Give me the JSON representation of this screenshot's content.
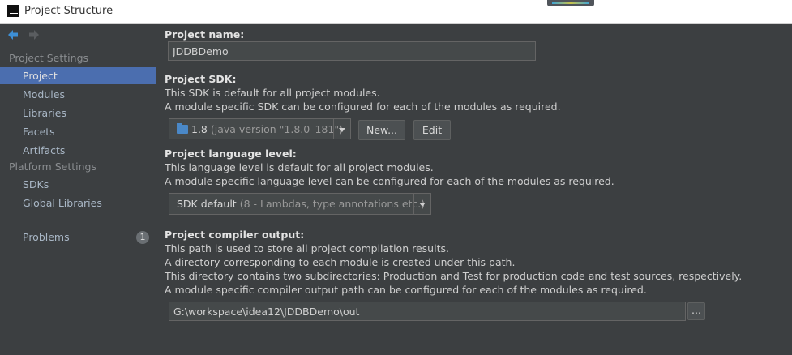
{
  "window": {
    "title": "Project Structure"
  },
  "sidebar": {
    "sections": [
      {
        "header": "Project Settings",
        "items": [
          "Project",
          "Modules",
          "Libraries",
          "Facets",
          "Artifacts"
        ]
      },
      {
        "header": "Platform Settings",
        "items": [
          "SDKs",
          "Global Libraries"
        ]
      }
    ],
    "selected": "Project",
    "problems": {
      "label": "Problems",
      "count": "1"
    }
  },
  "main": {
    "project_name": {
      "label": "Project name:",
      "value": "JDDBDemo"
    },
    "project_sdk": {
      "label": "Project SDK:",
      "desc": [
        "This SDK is default for all project modules.",
        "A module specific SDK can be configured for each of the modules as required."
      ],
      "selected_version": "1.8",
      "selected_hint": "(java version \"1.8.0_181\")",
      "new_button": "New...",
      "edit_button": "Edit"
    },
    "language_level": {
      "label": "Project language level:",
      "desc": [
        "This language level is default for all project modules.",
        "A module specific language level can be configured for each of the modules as required."
      ],
      "selected_main": "SDK default",
      "selected_hint": "(8 - Lambdas, type annotations etc.)"
    },
    "compiler_output": {
      "label": "Project compiler output:",
      "desc": [
        "This path is used to store all project compilation results.",
        "A directory corresponding to each module is created under this path.",
        "This directory contains two subdirectories: Production and Test for production code and test sources, respectively.",
        "A module specific compiler output path can be configured for each of the modules as required."
      ],
      "path": "G:\\workspace\\idea12\\JDDBDemo\\out",
      "browse_button": "..."
    }
  },
  "colors": {
    "background": "#3c3f41",
    "selection": "#4b6eaf",
    "field": "#45494a"
  }
}
